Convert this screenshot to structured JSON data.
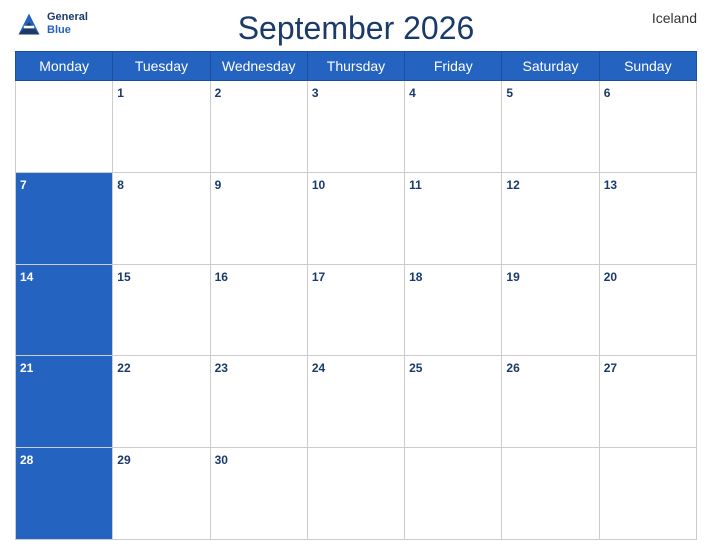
{
  "header": {
    "title": "September 2026",
    "country": "Iceland",
    "logo": {
      "line1": "General",
      "line2": "Blue"
    }
  },
  "calendar": {
    "weekdays": [
      "Monday",
      "Tuesday",
      "Wednesday",
      "Thursday",
      "Friday",
      "Saturday",
      "Sunday"
    ],
    "weeks": [
      [
        null,
        1,
        2,
        3,
        4,
        5,
        6
      ],
      [
        7,
        8,
        9,
        10,
        11,
        12,
        13
      ],
      [
        14,
        15,
        16,
        17,
        18,
        19,
        20
      ],
      [
        21,
        22,
        23,
        24,
        25,
        26,
        27
      ],
      [
        28,
        29,
        30,
        null,
        null,
        null,
        null
      ]
    ]
  }
}
